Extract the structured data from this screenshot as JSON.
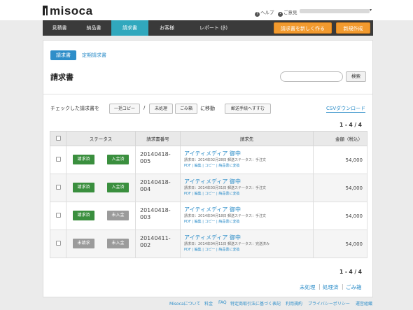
{
  "brand": {
    "name": "misoca"
  },
  "utility": {
    "help": "ヘルプ",
    "feedback": "ご意見"
  },
  "nav": {
    "items": [
      {
        "label": "見積書"
      },
      {
        "label": "納品書"
      },
      {
        "label": "請求書"
      },
      {
        "label": "お客様"
      },
      {
        "label": "レポート (β)"
      }
    ],
    "create_invoice": "請求書を新しく作る",
    "create": "新規作成"
  },
  "subtabs": {
    "active": "請求書",
    "other": "定期請求書"
  },
  "page": {
    "title": "請求書"
  },
  "search": {
    "placeholder": "",
    "button": "検索"
  },
  "bulk": {
    "label": "チェックした請求書を",
    "copy": "一括コピー",
    "slash": "/",
    "unprocessed": "未処理",
    "trash": "ごみ箱",
    "move_label": "に移動",
    "mail": "郵送手続へすすむ",
    "csv": "CSVダウンロード"
  },
  "pagination": {
    "top": "1 - 4 / 4",
    "bottom": "1 - 4 / 4"
  },
  "table": {
    "headers": [
      "",
      "ステータス",
      "請求書番号",
      "請求先",
      "金額（税込）"
    ],
    "rows": [
      {
        "status1": "請求済",
        "status2": "入金済",
        "num1": "20140418-",
        "num2": "005",
        "client": "アイティメディア 御中",
        "meta": "請求日：2014年02月28日 郵送ステータス：手注文",
        "links": "PDF | 編集 | コピー | 納品書に変換",
        "amount": "54,000"
      },
      {
        "status1": "請求済",
        "status2": "入金済",
        "num1": "20140418-",
        "num2": "004",
        "client": "アイティメディア 御中",
        "meta": "請求日：2014年03月31日 郵送ステータス：手注文",
        "links": "PDF | 編集 | コピー | 納品書に変換",
        "amount": "54,000"
      },
      {
        "status1": "請求済",
        "status2": "未入金",
        "num1": "20140418-",
        "num2": "003",
        "client": "アイティメディア 御中",
        "meta": "請求日：2014年04月18日 郵送ステータス：手注文",
        "links": "PDF | 編集 | コピー | 納品書に変換",
        "amount": "54,000"
      },
      {
        "status1": "未請求",
        "status2": "未入金",
        "num1": "20140411-",
        "num2": "002",
        "client": "アイティメディア 御中",
        "meta": "請求日：2014年04月11日 郵送ステータス：完送済み",
        "links": "PDF | 編集 | コピー | 納品書に変換",
        "amount": "54,000"
      }
    ]
  },
  "folders": {
    "unprocessed": "未処理",
    "processed": "処理済",
    "trash": "ごみ箱"
  },
  "footer": {
    "about": "Misocaについて",
    "pricing": "料金",
    "faq": "FAQ",
    "law": "特定商取引法に基づく表記",
    "terms": "利用規約",
    "privacy": "プライバシーポリシー",
    "company": "運営組織"
  },
  "colors": {
    "accent": "#31a8bd",
    "orange": "#f29a2e",
    "green": "#3a8f3e",
    "gray": "#9b9b9b",
    "link": "#2e8ec9",
    "nav": "#3a3a3a"
  }
}
